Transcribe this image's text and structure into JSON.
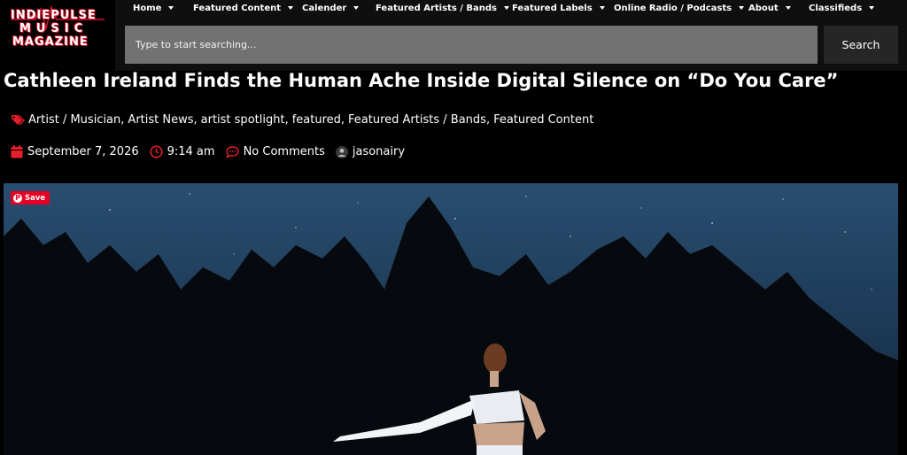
{
  "logo": {
    "line1": "INDIEPULSE",
    "line2": "MUSIC",
    "line3": "MAGAZINE"
  },
  "nav": {
    "items": [
      {
        "label": "Home"
      },
      {
        "label": "Featured Content"
      },
      {
        "label": "Calender"
      },
      {
        "label": "Featured Artists / Bands"
      },
      {
        "label": "Featured Labels"
      },
      {
        "label": "Online Radio / Podcasts"
      },
      {
        "label": "About"
      },
      {
        "label": "Classifieds"
      }
    ]
  },
  "search": {
    "placeholder": "Type to start searching...",
    "button_label": "Search"
  },
  "article": {
    "title": "Cathleen Ireland Finds the Human Ache Inside Digital Silence on “Do You Care”",
    "categories": [
      "Artist / Musician",
      "Artist News",
      "artist spotlight",
      "featured",
      "Featured Artists / Bands",
      "Featured Content"
    ],
    "date": "September 7, 2026",
    "time": "9:14 am",
    "comments": "No Comments",
    "author": "jasonairy"
  },
  "pinterest": {
    "save_label": "Save"
  },
  "colors": {
    "accent": "#e61e2b",
    "pinterest": "#e60023",
    "header_bg": "#0f0f0f",
    "search_bg": "#727272",
    "search_button_bg": "#262626"
  },
  "icons": [
    "tags-icon",
    "calendar-icon",
    "clock-icon",
    "comment-icon",
    "avatar",
    "pinterest-icon"
  ]
}
